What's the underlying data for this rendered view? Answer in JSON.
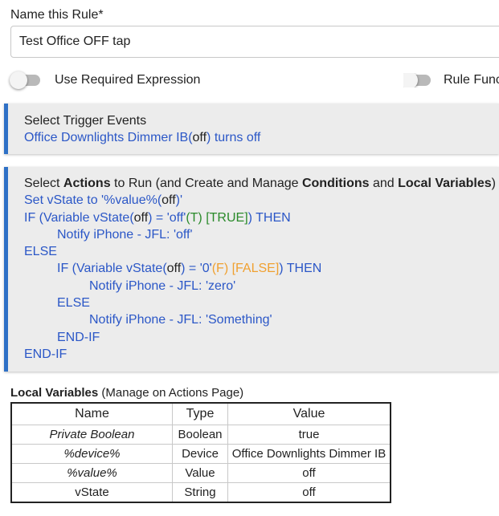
{
  "rule_name": {
    "label": "Name this Rule*",
    "value": "Test Office OFF tap"
  },
  "toggles": {
    "required_expression": "Use Required Expression",
    "rule_functions": "Rule Funct"
  },
  "trigger": {
    "heading": "Select Trigger Events",
    "event_device": "Office Downlights Dimmer IB",
    "event_state": "off",
    "event_action": "turns off"
  },
  "actions": {
    "heading_parts": [
      "Select ",
      "Actions",
      " to Run (and Create and Manage ",
      "Conditions",
      " and ",
      "Local Variables",
      ")"
    ],
    "lines": [
      {
        "indent": 0,
        "segments": [
          {
            "t": "Set vState to '%value%(",
            "c": "blue"
          },
          {
            "t": "off",
            "c": "blk"
          },
          {
            "t": ")'",
            "c": "blue"
          }
        ]
      },
      {
        "indent": 0,
        "segments": [
          {
            "t": "IF (Variable vState(",
            "c": "blue"
          },
          {
            "t": "off",
            "c": "blk"
          },
          {
            "t": ") = 'off'",
            "c": "blue"
          },
          {
            "t": "(T) [TRUE]",
            "c": "green"
          },
          {
            "t": ") THEN",
            "c": "blue"
          }
        ]
      },
      {
        "indent": 1,
        "segments": [
          {
            "t": "Notify iPhone   - JFL: 'off'",
            "c": "blue"
          }
        ]
      },
      {
        "indent": 0,
        "segments": [
          {
            "t": "ELSE",
            "c": "blue"
          }
        ]
      },
      {
        "indent": 1,
        "segments": [
          {
            "t": "IF (Variable vState(",
            "c": "blue"
          },
          {
            "t": "off",
            "c": "blk"
          },
          {
            "t": ") = '0'",
            "c": "blue"
          },
          {
            "t": "(F) [FALSE]",
            "c": "orange"
          },
          {
            "t": ") THEN",
            "c": "blue"
          }
        ]
      },
      {
        "indent": 2,
        "segments": [
          {
            "t": "Notify iPhone   - JFL: 'zero'",
            "c": "blue"
          }
        ]
      },
      {
        "indent": 1,
        "segments": [
          {
            "t": "ELSE",
            "c": "blue"
          }
        ]
      },
      {
        "indent": 2,
        "segments": [
          {
            "t": "Notify iPhone   - JFL: 'Something'",
            "c": "blue"
          }
        ]
      },
      {
        "indent": 1,
        "segments": [
          {
            "t": "END-IF",
            "c": "blue"
          }
        ]
      },
      {
        "indent": 0,
        "segments": [
          {
            "t": "END-IF",
            "c": "blue"
          }
        ]
      }
    ]
  },
  "local_variables": {
    "title_bold": "Local Variables",
    "title_note": " (Manage on Actions Page)",
    "columns": [
      "Name",
      "Type",
      "Value"
    ],
    "rows": [
      {
        "name": "Private Boolean",
        "italic": true,
        "type": "Boolean",
        "value": "true"
      },
      {
        "name": "%device%",
        "italic": true,
        "type": "Device",
        "value": "Office Downlights Dimmer IB"
      },
      {
        "name": "%value%",
        "italic": true,
        "type": "Value",
        "value": "off"
      },
      {
        "name": "vState",
        "italic": false,
        "type": "String",
        "value": "off"
      }
    ]
  }
}
